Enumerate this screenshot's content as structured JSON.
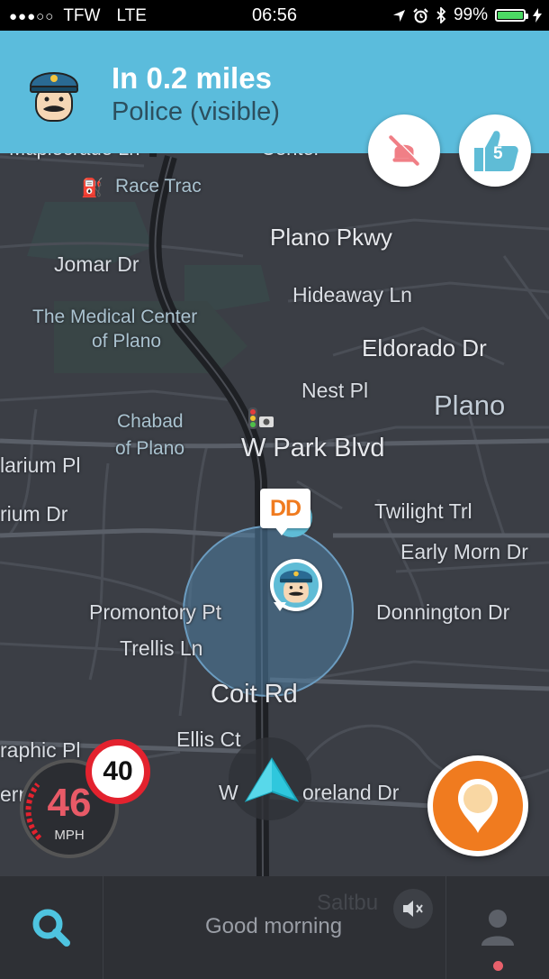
{
  "status_bar": {
    "signal_dots": "●●●○○",
    "carrier": "TFW",
    "network": "LTE",
    "time": "06:56",
    "battery_percent": "99%",
    "battery_level": 0.99
  },
  "alert_banner": {
    "distance": "In 0.2 miles",
    "alert_type": "Police (visible)",
    "icon": "police-officer-icon"
  },
  "alert_actions": {
    "not_there_icon": "not-there-icon",
    "thanks_icon": "thumbs-up-icon",
    "thanks_count": "5"
  },
  "map_labels": {
    "partial_top_left": "Maplecrade Ln",
    "partial_top_center": "Center",
    "race_trac": "Race Trac",
    "plano_pkwy": "Plano Pkwy",
    "jomar_dr": "Jomar Dr",
    "hideaway_ln": "Hideaway Ln",
    "medical_center_1": "The Medical Center",
    "medical_center_2": "of Plano",
    "eldorado_dr": "Eldorado Dr",
    "nest_pl": "Nest Pl",
    "plano": "Plano",
    "chabad_1": "Chabad",
    "chabad_2": "of Plano",
    "w_park_blvd": "W Park Blvd",
    "larium_pl": "larium Pl",
    "rium_dr": "rium Dr",
    "twilight_trl": "Twilight Trl",
    "early_morn_dr": "Early Morn Dr",
    "promontory_pt": "Promontory Pt",
    "donnington_dr": "Donnington Dr",
    "trellis_ln": "Trellis Ln",
    "coit_rd": "Coit Rd",
    "ellis_ct": "Ellis Ct",
    "raphic_pl": "raphic Pl",
    "ern": "ern",
    "moreland_dr_w": "W",
    "moreland_dr": "oreland Dr",
    "saltbush": "Saltbu"
  },
  "map_pins": {
    "dunkin_logo": "DD",
    "police_pin": "police-officer-icon"
  },
  "speed": {
    "current": "46",
    "unit": "MPH",
    "limit": "40"
  },
  "bottom_bar": {
    "greeting": "Good morning",
    "search_icon": "search-icon",
    "profile_icon": "profile-icon",
    "mute_icon": "sound-muted-icon"
  },
  "colors": {
    "banner": "#5bbcdc",
    "map_bg": "#3b3e45",
    "speed_warning": "#e85a67",
    "limit_ring": "#e3222e",
    "report": "#f07b1f",
    "nav_arrow": "#2fc7dd"
  }
}
